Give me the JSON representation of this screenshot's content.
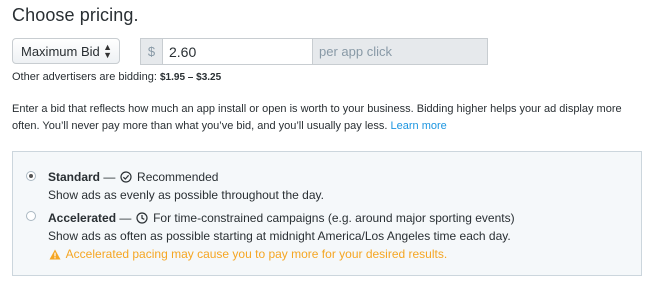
{
  "heading": "Choose pricing.",
  "bid_type": {
    "selected": "Maximum Bid"
  },
  "amount": {
    "currency_symbol": "$",
    "value": "2.60",
    "unit": "per app click"
  },
  "others": {
    "label": "Other advertisers are bidding:",
    "range": "$1.95 – $3.25"
  },
  "description": {
    "text": "Enter a bid that reflects how much an app install or open is worth to your business. Bidding higher helps your ad display more often. You’ll never pay more than what you’ve bid, and you’ll usually pay less.",
    "link": "Learn more"
  },
  "pacing": {
    "standard": {
      "title": "Standard",
      "dash": "—",
      "tag": "Recommended",
      "description": "Show ads as evenly as possible throughout the day.",
      "selected": true
    },
    "accelerated": {
      "title": "Accelerated",
      "dash": "—",
      "tag": "For time-constrained campaigns (e.g. around major sporting events)",
      "description": "Show ads as often as possible starting at midnight America/Los Angeles time each day.",
      "warning": "Accelerated pacing may cause you to pay more for your desired results.",
      "selected": false
    }
  },
  "colors": {
    "link": "#1b95e0",
    "warning": "#f5a623",
    "panel_bg": "#f5f8fa"
  }
}
